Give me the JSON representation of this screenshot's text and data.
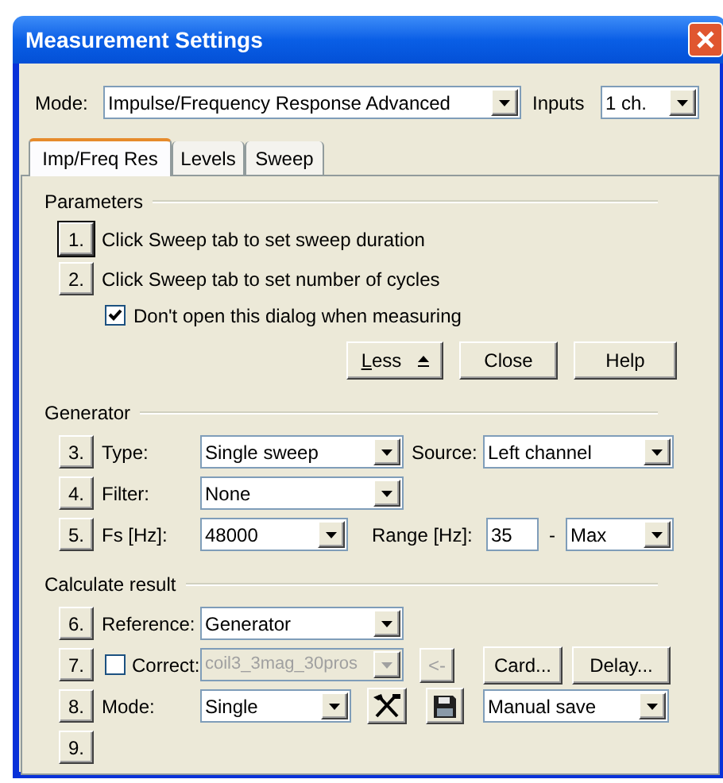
{
  "window": {
    "title": "Measurement Settings"
  },
  "mode": {
    "label": "Mode:",
    "value": "Impulse/Frequency Response Advanced"
  },
  "inputs": {
    "label": "Inputs",
    "value": "1 ch."
  },
  "tabs": [
    {
      "label": "Imp/Freq Res",
      "selected": true
    },
    {
      "label": "Levels",
      "selected": false
    },
    {
      "label": "Sweep",
      "selected": false
    }
  ],
  "parameters": {
    "title": "Parameters",
    "steps": [
      {
        "number": "1.",
        "text": "Click Sweep tab to set sweep duration",
        "focused": true
      },
      {
        "number": "2.",
        "text": "Click Sweep tab to set number of cycles",
        "focused": false
      }
    ],
    "dont_open": {
      "label": "Don't open this dialog when measuring",
      "checked": true
    }
  },
  "actions": [
    {
      "label": "Less",
      "kind": "toggle"
    },
    {
      "label": "Close",
      "kind": "plain"
    },
    {
      "label": "Help",
      "kind": "plain"
    }
  ],
  "generator": {
    "title": "Generator",
    "type": {
      "number": "3.",
      "label": "Type:",
      "value": "Single sweep"
    },
    "source": {
      "label": "Source:",
      "value": "Left channel"
    },
    "filter": {
      "number": "4.",
      "label": "Filter:",
      "value": "None"
    },
    "fs": {
      "number": "5.",
      "label": "Fs [Hz]:",
      "value": "48000"
    },
    "range": {
      "label": "Range [Hz]:",
      "from": "35",
      "separator": "-",
      "to": "Max"
    }
  },
  "calculate": {
    "title": "Calculate result",
    "reference": {
      "number": "6.",
      "label": "Reference:",
      "value": "Generator"
    },
    "correct": {
      "number": "7.",
      "label": "Correct:",
      "checked": false,
      "value": "coil3_3mag_30pros",
      "disabled": true
    },
    "back": {
      "label": "<-",
      "disabled": true
    },
    "card": {
      "label": "Card..."
    },
    "delay": {
      "label": "Delay..."
    },
    "mode": {
      "number": "8.",
      "label": "Mode:",
      "value": "Single"
    },
    "save": {
      "value": "Manual save"
    },
    "step_9": {
      "number": "9."
    }
  }
}
